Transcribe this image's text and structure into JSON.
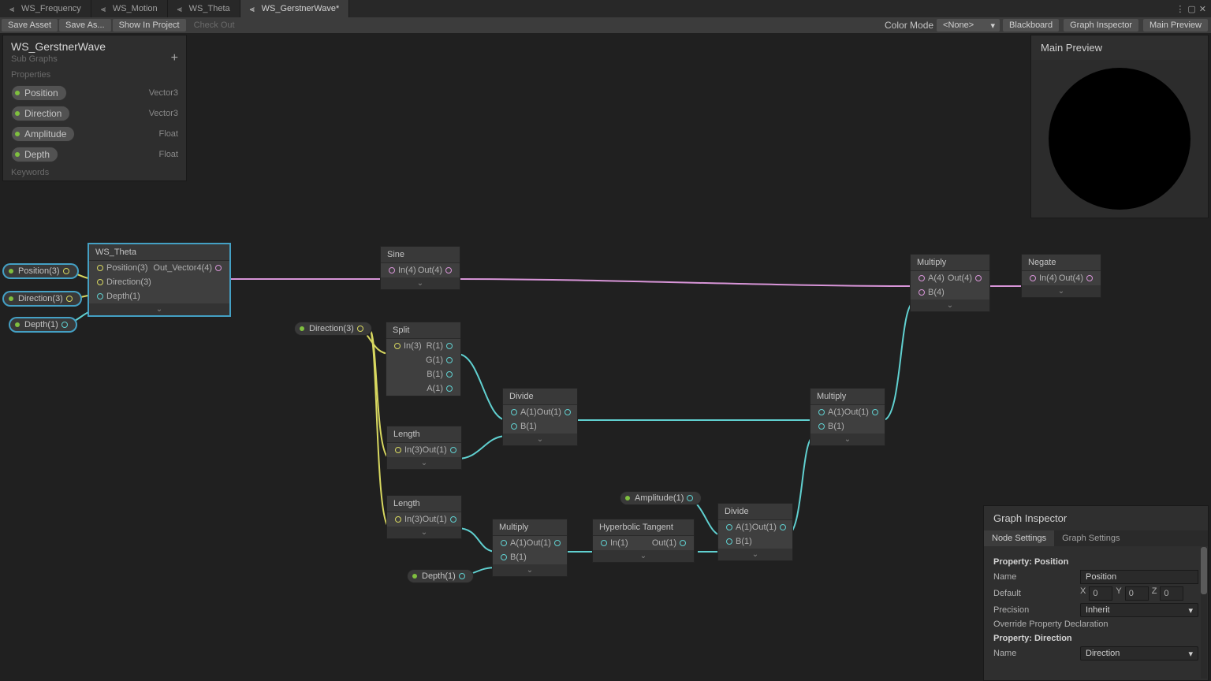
{
  "tabs": [
    {
      "label": "WS_Frequency"
    },
    {
      "label": "WS_Motion"
    },
    {
      "label": "WS_Theta"
    },
    {
      "label": "WS_GerstnerWave*",
      "active": true
    }
  ],
  "toolbar": {
    "save_asset": "Save Asset",
    "save_as": "Save As...",
    "show_in_project": "Show In Project",
    "check_out": "Check Out",
    "color_mode": "Color Mode",
    "color_mode_value": "<None>",
    "blackboard_btn": "Blackboard",
    "graph_inspector_btn": "Graph Inspector",
    "main_preview_btn": "Main Preview"
  },
  "blackboard": {
    "title": "WS_GerstnerWave",
    "sub": "Sub Graphs",
    "section_props": "Properties",
    "section_keywords": "Keywords",
    "props": [
      {
        "name": "Position",
        "type": "Vector3"
      },
      {
        "name": "Direction",
        "type": "Vector3"
      },
      {
        "name": "Amplitude",
        "type": "Float"
      },
      {
        "name": "Depth",
        "type": "Float"
      }
    ]
  },
  "main_preview": {
    "title": "Main Preview"
  },
  "inspector": {
    "title": "Graph Inspector",
    "tab1": "Node Settings",
    "tab2": "Graph Settings",
    "prop1_header": "Property: Position",
    "name_label": "Name",
    "name_value": "Position",
    "default_label": "Default",
    "x": "X",
    "y": "Y",
    "z": "Z",
    "zero": "0",
    "precision_label": "Precision",
    "precision_value": "Inherit",
    "override_label": "Override Property Declaration",
    "prop2_header": "Property: Direction",
    "name2_value": "Direction"
  },
  "nodes": {
    "ws_theta": {
      "title": "WS_Theta",
      "in1": "Position(3)",
      "in2": "Direction(3)",
      "in3": "Depth(1)",
      "out": "Out_Vector4(4)"
    },
    "sine": {
      "title": "Sine",
      "in": "In(4)",
      "out": "Out(4)"
    },
    "multiply5": {
      "title": "Multiply",
      "inA": "A(4)",
      "inB": "B(4)",
      "out": "Out(4)"
    },
    "negate": {
      "title": "Negate",
      "in": "In(4)",
      "out": "Out(4)"
    },
    "split": {
      "title": "Split",
      "in": "In(3)",
      "r": "R(1)",
      "g": "G(1)",
      "b": "B(1)",
      "a": "A(1)"
    },
    "length1": {
      "title": "Length",
      "in": "In(3)",
      "out": "Out(1)"
    },
    "length2": {
      "title": "Length",
      "in": "In(3)",
      "out": "Out(1)"
    },
    "divide1": {
      "title": "Divide",
      "inA": "A(1)",
      "inB": "B(1)",
      "out": "Out(1)"
    },
    "multiply3": {
      "title": "Multiply",
      "inA": "A(1)",
      "inB": "B(1)",
      "out": "Out(1)"
    },
    "multiply1": {
      "title": "Multiply",
      "inA": "A(1)",
      "inB": "B(1)",
      "out": "Out(1)"
    },
    "htan": {
      "title": "Hyperbolic Tangent",
      "in": "In(1)",
      "out": "Out(1)"
    },
    "divide2": {
      "title": "Divide",
      "inA": "A(1)",
      "inB": "B(1)",
      "out": "Out(1)"
    }
  },
  "tokens": {
    "position": "Position(3)",
    "direction": "Direction(3)",
    "depth": "Depth(1)",
    "direction2": "Direction(3)",
    "depth2": "Depth(1)",
    "amplitude": "Amplitude(1)"
  }
}
